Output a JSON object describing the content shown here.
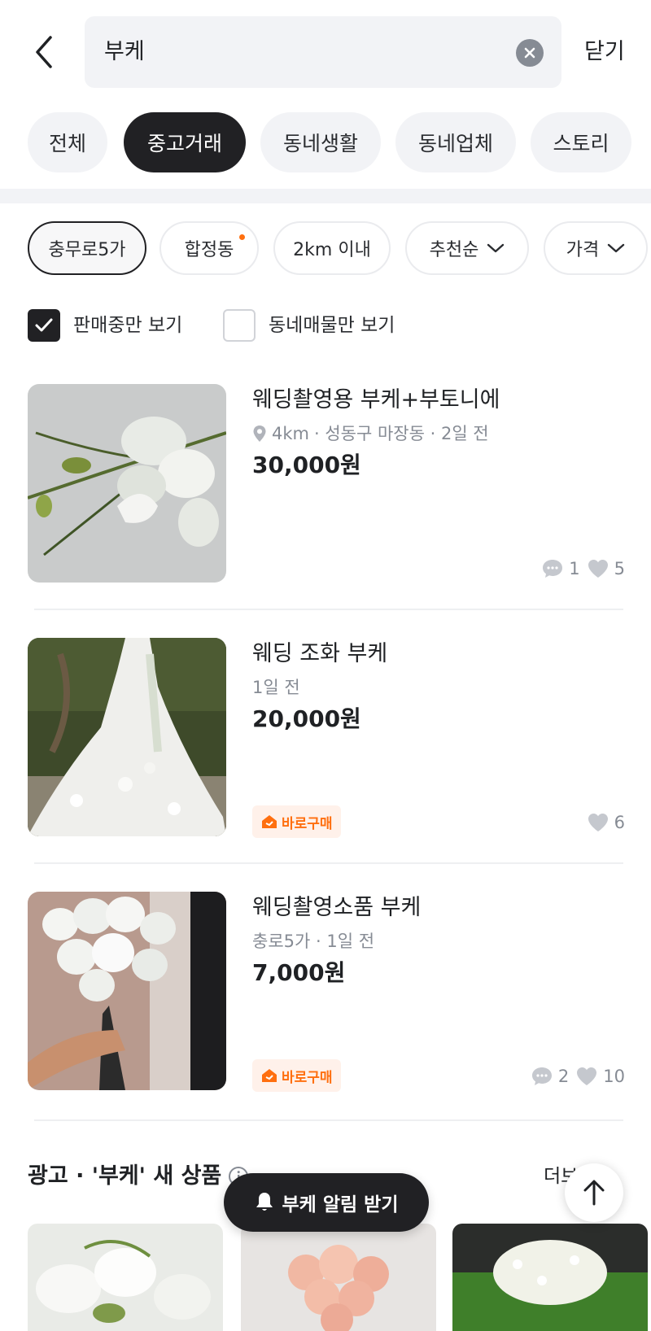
{
  "header": {
    "search_query": "부케",
    "close_label": "닫기"
  },
  "categories": [
    {
      "label": "전체",
      "active": false
    },
    {
      "label": "중고거래",
      "active": true
    },
    {
      "label": "동네생활",
      "active": false
    },
    {
      "label": "동네업체",
      "active": false
    },
    {
      "label": "스토리",
      "active": false
    }
  ],
  "filters": [
    {
      "label": "충무로5가",
      "selected": true
    },
    {
      "label": "합정동",
      "new_dot": true
    },
    {
      "label": "2km 이내"
    },
    {
      "label": "추천순",
      "dropdown": true
    },
    {
      "label": "가격",
      "dropdown": true
    }
  ],
  "checkboxes": [
    {
      "label": "판매중만 보기",
      "checked": true
    },
    {
      "label": "동네매물만 보기",
      "checked": false
    }
  ],
  "listings": [
    {
      "title": "웨딩촬영용 부케+부토니에",
      "distance": "4km",
      "meta": "· 성동구 마장동 · 2일 전",
      "price": "30,000원",
      "comments": "1",
      "likes": "5",
      "badge": ""
    },
    {
      "title": "웨딩 조화 부케",
      "meta": "1일 전",
      "price": "20,000원",
      "likes": "6",
      "badge": "바로구매"
    },
    {
      "title": "웨딩촬영소품 부케",
      "meta": "충로5가 · 1일 전",
      "price": "7,000원",
      "comments": "2",
      "likes": "10",
      "badge": "바로구매"
    }
  ],
  "ad": {
    "title": "광고 · '부케' 새 상품",
    "more_label": "더보기"
  },
  "alert_button": "부케 알림 받기",
  "colors": {
    "accent": "#ff6f0f",
    "dark": "#212124",
    "muted": "#868b94"
  }
}
